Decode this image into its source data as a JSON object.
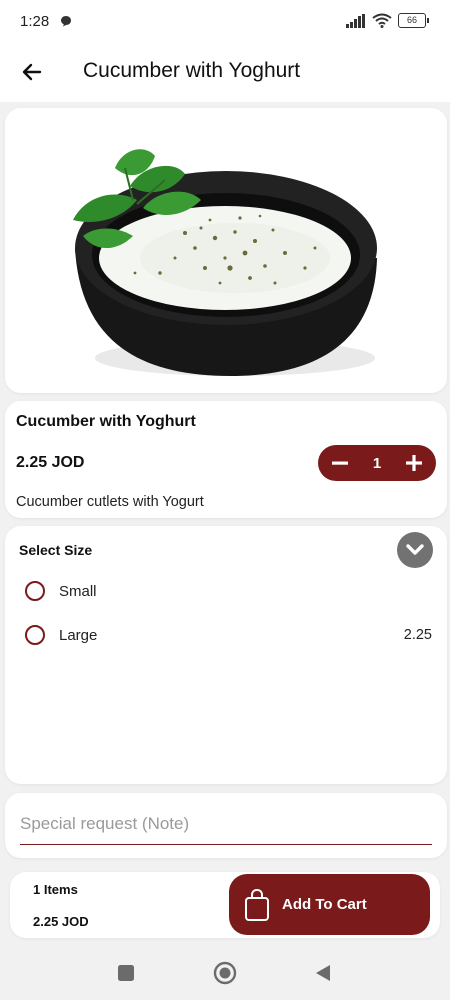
{
  "status": {
    "time": "1:28",
    "battery": "66"
  },
  "header": {
    "title": "Cucumber with Yoghurt"
  },
  "product": {
    "name": "Cucumber with Yoghurt",
    "price": "2.25  JOD",
    "description": "Cucumber cutlets with Yogurt",
    "quantity": "1"
  },
  "size": {
    "title": "Select Size",
    "options": [
      {
        "label": "Small",
        "price": ""
      },
      {
        "label": "Large",
        "price": "2.25"
      }
    ]
  },
  "note": {
    "placeholder": "Special request (Note)",
    "value": ""
  },
  "footer": {
    "items": "1 Items",
    "total": "2.25  JOD",
    "add_label": "Add To Cart"
  },
  "colors": {
    "accent": "#7a1a1a",
    "background": "#f1f1f1",
    "card": "#ffffff"
  }
}
